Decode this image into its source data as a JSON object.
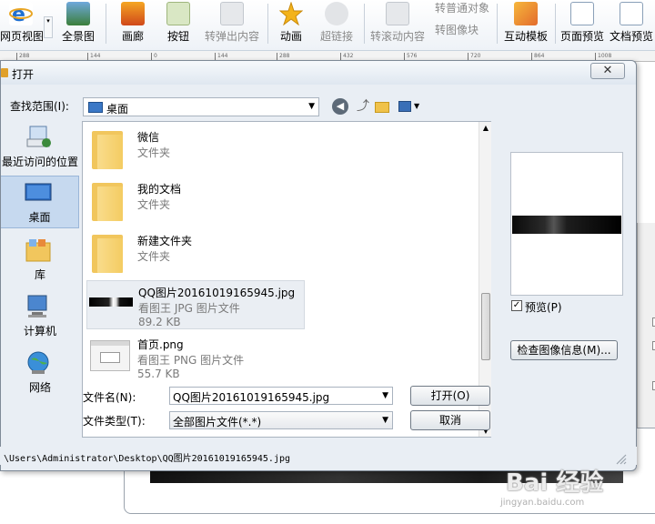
{
  "toolbar": {
    "items": [
      {
        "label": "网页视图",
        "icon": "ie-icon",
        "disabled": false
      },
      {
        "label": "全景图",
        "icon": "panorama-icon",
        "disabled": false
      },
      {
        "label": "画廊",
        "icon": "gallery-icon",
        "disabled": false
      },
      {
        "label": "按钮",
        "icon": "button-icon",
        "disabled": false
      },
      {
        "label": "转弹出内容",
        "icon": "popup-icon",
        "disabled": true
      },
      {
        "label": "动画",
        "icon": "star-icon",
        "disabled": false
      },
      {
        "label": "超链接",
        "icon": "link-icon",
        "disabled": true
      },
      {
        "label": "转滚动内容",
        "icon": "scroll-icon",
        "disabled": true
      },
      {
        "label": "互动模板",
        "icon": "template-icon",
        "disabled": false
      },
      {
        "label": "页面预览",
        "icon": "page-preview-icon",
        "disabled": false
      },
      {
        "label": "文档预览",
        "icon": "doc-preview-icon",
        "disabled": false
      }
    ],
    "small_items": [
      "转普通对象",
      "转图像块"
    ]
  },
  "ruler": [
    "288",
    "144",
    "0",
    "144",
    "288",
    "432",
    "576",
    "720",
    "864",
    "1008"
  ],
  "dialog": {
    "title": "打开",
    "close_glyph": "✕",
    "look_in_label": "查找范围(I):",
    "look_in_value": "桌面",
    "places": [
      {
        "label": "最近访问的位置",
        "icon": "recent-places-icon"
      },
      {
        "label": "桌面",
        "icon": "desktop-icon",
        "selected": true
      },
      {
        "label": "库",
        "icon": "library-icon"
      },
      {
        "label": "计算机",
        "icon": "computer-icon"
      },
      {
        "label": "网络",
        "icon": "network-icon"
      }
    ],
    "files": [
      {
        "name": "微信",
        "type": "文件夹",
        "size": "",
        "icon": "folder-icon"
      },
      {
        "name": "我的文档",
        "type": "文件夹",
        "size": "",
        "icon": "folder-icon"
      },
      {
        "name": "新建文件夹",
        "type": "文件夹",
        "size": "",
        "icon": "folder-icon"
      },
      {
        "name": "QQ图片20161019165945.jpg",
        "type": "看图王 JPG 图片文件",
        "size": "89.2 KB",
        "icon": "jpg-thumbnail",
        "selected": true
      },
      {
        "name": "首页.png",
        "type": "看图王 PNG 图片文件",
        "size": "55.7 KB",
        "icon": "png-thumbnail"
      }
    ],
    "file_name_label": "文件名(N):",
    "file_name_value": "QQ图片20161019165945.jpg",
    "file_type_label": "文件类型(T):",
    "file_type_value": "全部图片文件(*.*)",
    "open_label": "打开(O)",
    "cancel_label": "取消",
    "preview_label": "预览(P)",
    "preview_checked": true,
    "image_info_label": "检查图像信息(M)...",
    "path": "\\Users\\Administrator\\Desktop\\QQ图片20161019165945.jpg"
  },
  "watermark": {
    "text": "Bai 经验",
    "sub": "jingyan.baidu.com"
  }
}
